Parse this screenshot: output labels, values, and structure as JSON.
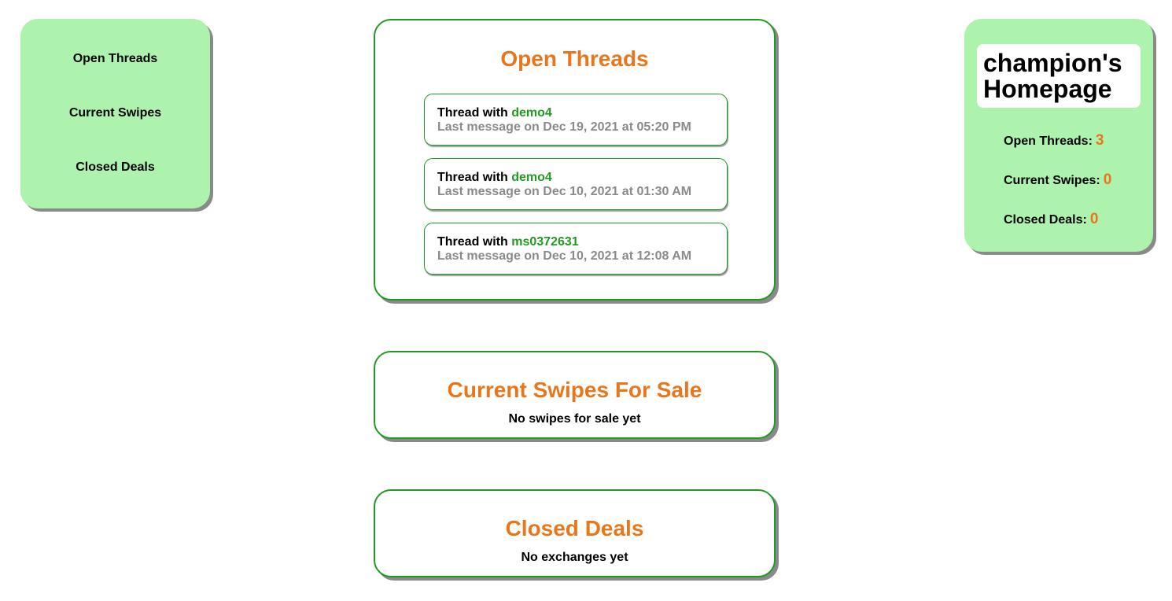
{
  "nav": {
    "items": [
      {
        "label": "Open Threads"
      },
      {
        "label": "Current Swipes"
      },
      {
        "label": "Closed Deals"
      }
    ]
  },
  "profile": {
    "title": "champion's Homepage",
    "stats": [
      {
        "label": "Open Threads:",
        "value": "3"
      },
      {
        "label": "Current Swipes:",
        "value": "0"
      },
      {
        "label": "Closed Deals:",
        "value": "0"
      }
    ]
  },
  "threads_card": {
    "title": "Open Threads",
    "threads": [
      {
        "prefix": "Thread with ",
        "user": "demo4",
        "last_message": "Last message on Dec 19, 2021 at 05:20 PM"
      },
      {
        "prefix": "Thread with ",
        "user": "demo4",
        "last_message": "Last message on Dec 10, 2021 at 01:30 AM"
      },
      {
        "prefix": "Thread with ",
        "user": "ms0372631",
        "last_message": "Last message on Dec 10, 2021 at 12:08 AM"
      }
    ]
  },
  "swipes_card": {
    "title": "Current Swipes For Sale",
    "empty_text": "No swipes for sale yet"
  },
  "deals_card": {
    "title": "Closed Deals",
    "empty_text": "No exchanges yet"
  },
  "colors": {
    "panel_green": "#adf2ad",
    "border_green": "#229922",
    "accent_orange": "#e8771c",
    "muted_gray": "#8a8a8a"
  }
}
